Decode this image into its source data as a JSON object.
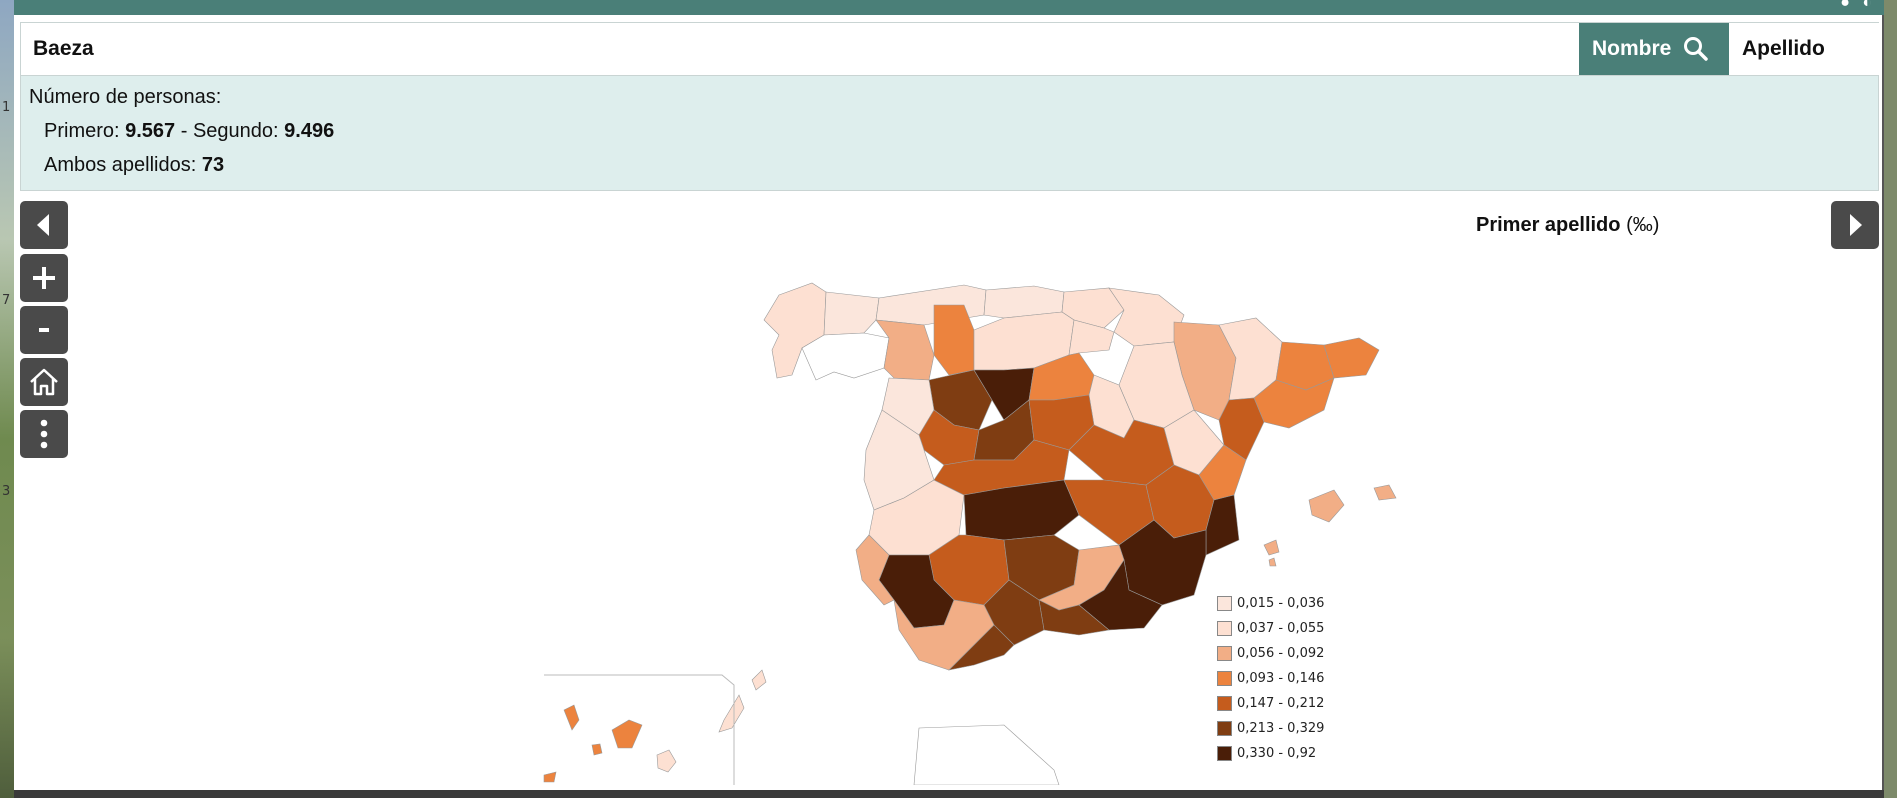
{
  "search": {
    "value": "Baeza"
  },
  "buttons": {
    "nombre": "Nombre",
    "apellido": "Apellido"
  },
  "info": {
    "heading": "Número de personas:",
    "primero_label": "Primero: ",
    "primero_value": "9.567",
    "separator": " - Segundo: ",
    "segundo_value": "9.496",
    "ambos_label": "Ambos apellidos: ",
    "ambos_value": "73"
  },
  "map": {
    "title": "Primer apellido",
    "unit": "(‰)",
    "legend": [
      {
        "label": "0,015 - 0,036",
        "color": "#fbe6dc"
      },
      {
        "label": "0,037 - 0,055",
        "color": "#fde0d2"
      },
      {
        "label": "0,056 - 0,092",
        "color": "#f2ae86"
      },
      {
        "label": "0,093 - 0,146",
        "color": "#ec833e"
      },
      {
        "label": "0,147 - 0,212",
        "color": "#c55c1d"
      },
      {
        "label": "0,213 - 0,329",
        "color": "#7f3d12"
      },
      {
        "label": "0,330 - 0,92",
        "color": "#4a1e08"
      }
    ]
  },
  "icons": {
    "prev": "chevron-left-icon",
    "zoom_in": "plus-icon",
    "zoom_out": "minus-icon",
    "home": "home-icon",
    "more": "more-vertical-icon",
    "next": "chevron-right-icon",
    "search": "search-icon"
  }
}
